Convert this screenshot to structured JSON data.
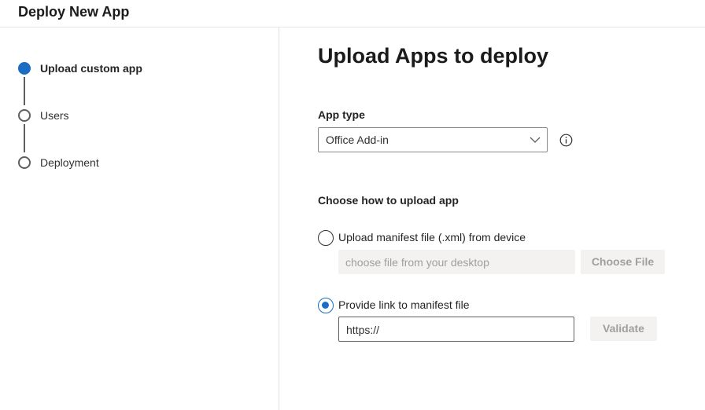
{
  "header": {
    "title": "Deploy New App"
  },
  "steps": [
    {
      "label": "Upload custom app",
      "state": "active"
    },
    {
      "label": "Users",
      "state": "pending"
    },
    {
      "label": "Deployment",
      "state": "pending"
    }
  ],
  "main": {
    "title": "Upload Apps to deploy",
    "app_type": {
      "label": "App type",
      "selected": "Office Add-in"
    },
    "upload_method": {
      "label": "Choose how to upload app",
      "options": [
        {
          "label": "Upload manifest file (.xml) from device",
          "checked": false,
          "input_placeholder": "choose file from your desktop",
          "button_label": "Choose File"
        },
        {
          "label": "Provide link to manifest file",
          "checked": true,
          "input_value": "https://",
          "button_label": "Validate"
        }
      ]
    }
  },
  "colors": {
    "accent": "#1a6cc4",
    "disabled_bg": "#f3f2f1",
    "disabled_text": "#a19f9d"
  },
  "icons": {
    "dropdown": "chevron-down-icon",
    "info": "info-icon"
  }
}
